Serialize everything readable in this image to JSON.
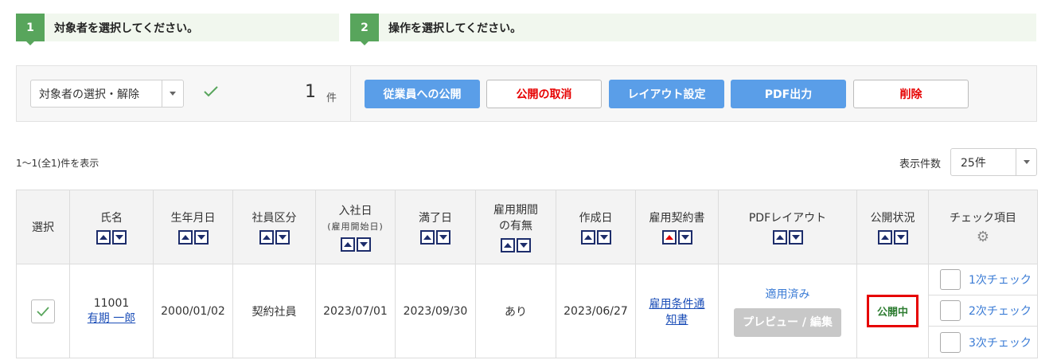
{
  "steps": [
    {
      "num": "1",
      "text": "対象者を選択してください。"
    },
    {
      "num": "2",
      "text": "操作を選択してください。"
    }
  ],
  "toolbar": {
    "selector_label": "対象者の選択・解除",
    "count": "1",
    "count_unit": "件",
    "buttons": {
      "publish": "従業員への公開",
      "unpublish": "公開の取消",
      "layout": "レイアウト設定",
      "pdf": "PDF出力",
      "delete": "削除"
    }
  },
  "info": {
    "showing": "1〜1(全1)件を表示",
    "per_page_label": "表示件数",
    "per_page_value": "25件"
  },
  "table": {
    "headers": {
      "select": "選択",
      "name": "氏名",
      "birth": "生年月日",
      "type": "社員区分",
      "join": "入社日",
      "join_sub": "(雇用開始日)",
      "expiry": "満了日",
      "period_1": "雇用期間",
      "period_2": "の有無",
      "created": "作成日",
      "contract": "雇用契約書",
      "pdf_layout": "PDFレイアウト",
      "status": "公開状況",
      "check": "チェック項目"
    },
    "row": {
      "id": "11001",
      "name": "有期 一郎",
      "birth": "2000/01/02",
      "type": "契約社員",
      "join": "2023/07/01",
      "expiry": "2023/09/30",
      "period": "あり",
      "created": "2023/06/27",
      "contract_1": "雇用条件通",
      "contract_2": "知書",
      "layout_status": "適用済み",
      "preview_btn": "プレビュー / 編集",
      "status": "公開中",
      "checks": [
        "1次チェック",
        "2次チェック",
        "3次チェック"
      ]
    }
  },
  "colors": {
    "step_green": "#58a55c",
    "button_blue": "#5a9ee8",
    "danger_red": "#e60000",
    "published_green": "#2e7d32"
  }
}
